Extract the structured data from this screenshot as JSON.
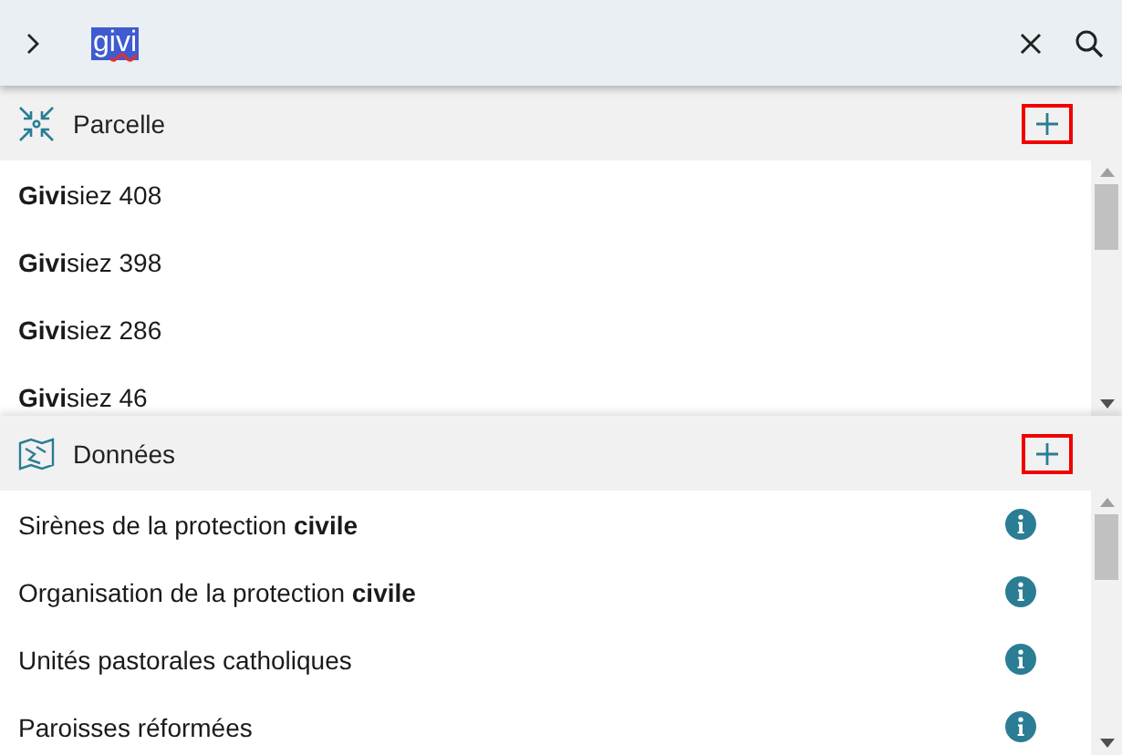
{
  "search": {
    "value": "givi",
    "selected": true
  },
  "sections": [
    {
      "title": "Parcelle",
      "kind": "parcel",
      "add_highlighted": true,
      "items": [
        {
          "label": "**Givi**siez 408",
          "info": false
        },
        {
          "label": "**Givi**siez 398",
          "info": false
        },
        {
          "label": "**Givi**siez 286",
          "info": false
        },
        {
          "label": "**Givi**siez 46",
          "info": false
        }
      ]
    },
    {
      "title": "Données",
      "kind": "data",
      "add_highlighted": true,
      "items": [
        {
          "label": "Sirènes de la protection **civile**",
          "info": true
        },
        {
          "label": "Organisation de la protection **civile**",
          "info": true
        },
        {
          "label": "Unités pastorales catholiques",
          "info": true
        },
        {
          "label": "Paroisses réformées",
          "info": true
        }
      ]
    }
  ]
}
